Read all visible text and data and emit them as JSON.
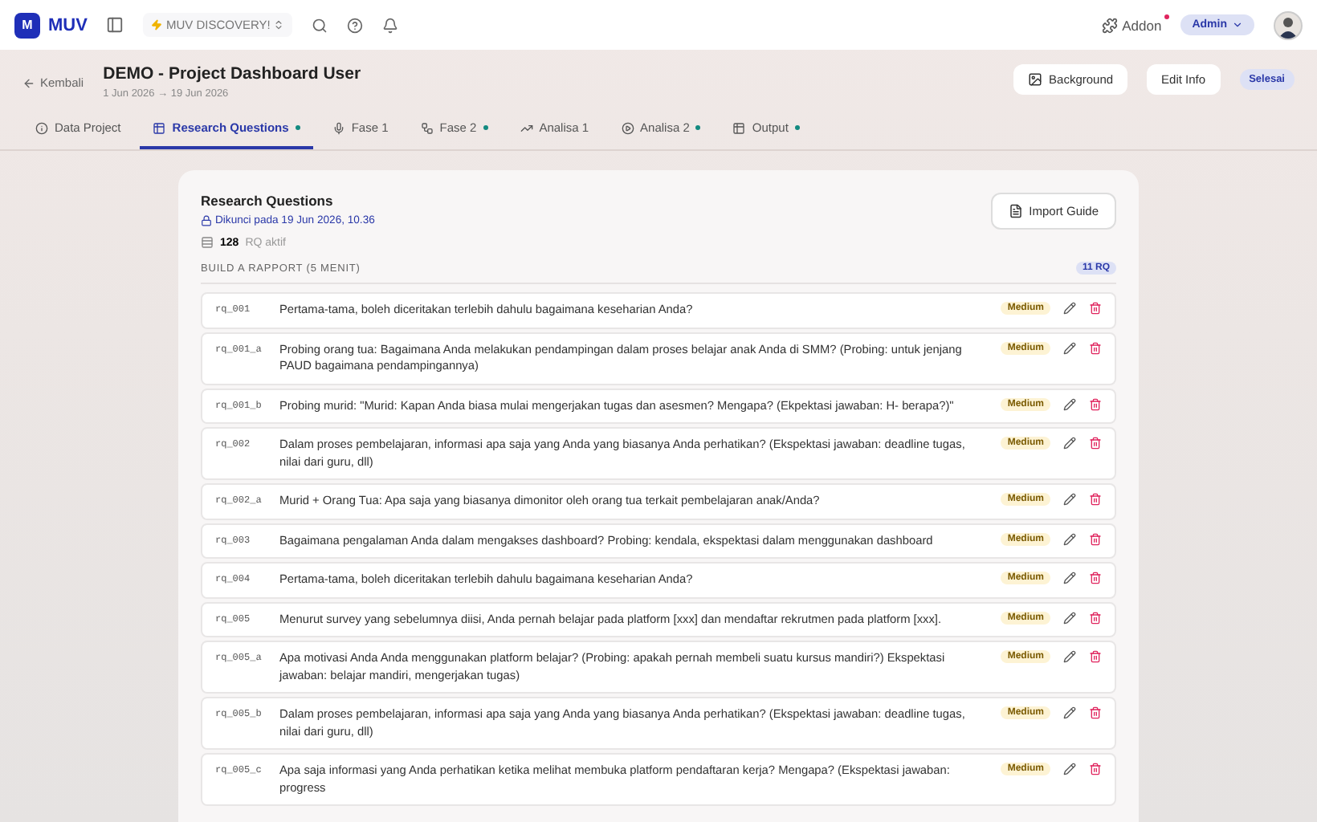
{
  "topbar": {
    "logo_mark": "M",
    "logo_text": "MUV",
    "workspace": "MUV DISCOVERY!",
    "addon": "Addon",
    "addon_notification": true,
    "role": "Admin"
  },
  "header": {
    "back": "Kembali",
    "title": "DEMO - Project Dashboard User",
    "dates": "1 Jun 2026 → 19 Jun 2026",
    "buttons": [
      {
        "label": "Background",
        "kind": "icon"
      },
      {
        "label": "Edit Info",
        "kind": "plain"
      }
    ],
    "status": "Selesai"
  },
  "tabs": [
    {
      "label": "Data Project",
      "selected": false,
      "dot": false
    },
    {
      "label": "Research Questions",
      "selected": true,
      "dot": true
    },
    {
      "label": "Fase 1",
      "selected": false,
      "dot": false
    },
    {
      "label": "Fase 2",
      "selected": false,
      "dot": true
    },
    {
      "label": "Analisa 1",
      "selected": false,
      "dot": false
    },
    {
      "label": "Analisa 2",
      "selected": false,
      "dot": true
    },
    {
      "label": "Output",
      "selected": false,
      "dot": true
    }
  ],
  "panel": {
    "title": "Research Questions",
    "locked": "Dikunci pada 19 Jun 2026, 10.36",
    "import": "Import Guide",
    "count": "128",
    "count_label": "RQ aktif",
    "section": {
      "title": "BUILD A RAPPORT (5 MENIT)",
      "badge": "11 RQ",
      "rows": [
        {
          "code": "rq_001",
          "text": "Pertama-tama, boleh diceritakan terlebih dahulu bagaimana keseharian Anda?",
          "priority": "Medium"
        },
        {
          "code": "rq_001_a",
          "text": "Probing orang tua: Bagaimana Anda melakukan pendampingan dalam proses belajar anak Anda di SMM? (Probing: untuk jenjang PAUD bagaimana pendampingannya)",
          "priority": "Medium"
        },
        {
          "code": "rq_001_b",
          "text": "Probing murid: \"Murid: Kapan Anda biasa mulai mengerjakan tugas dan asesmen? Mengapa? (Ekpektasi jawaban: H- berapa?)\"",
          "priority": "Medium"
        },
        {
          "code": "rq_002",
          "text": "Dalam proses pembelajaran, informasi apa saja yang Anda yang biasanya Anda perhatikan? (Ekspektasi jawaban: deadline tugas, nilai dari guru, dll)",
          "priority": "Medium"
        },
        {
          "code": "rq_002_a",
          "text": "Murid + Orang Tua: Apa saja yang biasanya dimonitor oleh orang tua terkait pembelajaran anak/Anda?",
          "priority": "Medium"
        },
        {
          "code": "rq_003",
          "text": "Bagaimana pengalaman Anda dalam mengakses dashboard? Probing: kendala, ekspektasi dalam menggunakan dashboard",
          "priority": "Medium"
        },
        {
          "code": "rq_004",
          "text": "Pertama-tama, boleh diceritakan terlebih dahulu bagaimana keseharian Anda?",
          "priority": "Medium"
        },
        {
          "code": "rq_005",
          "text": "Menurut survey yang sebelumnya diisi, Anda pernah belajar pada platform [xxx] dan mendaftar rekrutmen pada platform [xxx].",
          "priority": "Medium"
        },
        {
          "code": "rq_005_a",
          "text": "Apa motivasi Anda Anda menggunakan platform belajar? (Probing: apakah pernah membeli suatu kursus mandiri?) Ekspektasi jawaban: belajar mandiri, mengerjakan tugas)",
          "priority": "Medium"
        },
        {
          "code": "rq_005_b",
          "text": "Dalam proses pembelajaran, informasi apa saja yang Anda yang biasanya Anda perhatikan? (Ekspektasi jawaban: deadline tugas, nilai dari guru, dll)",
          "priority": "Medium"
        },
        {
          "code": "rq_005_c",
          "text": "Apa saja informasi yang Anda perhatikan ketika melihat membuka platform pendaftaran kerja? Mengapa? (Ekspektasi jawaban: progress",
          "priority": "Medium"
        }
      ]
    }
  }
}
